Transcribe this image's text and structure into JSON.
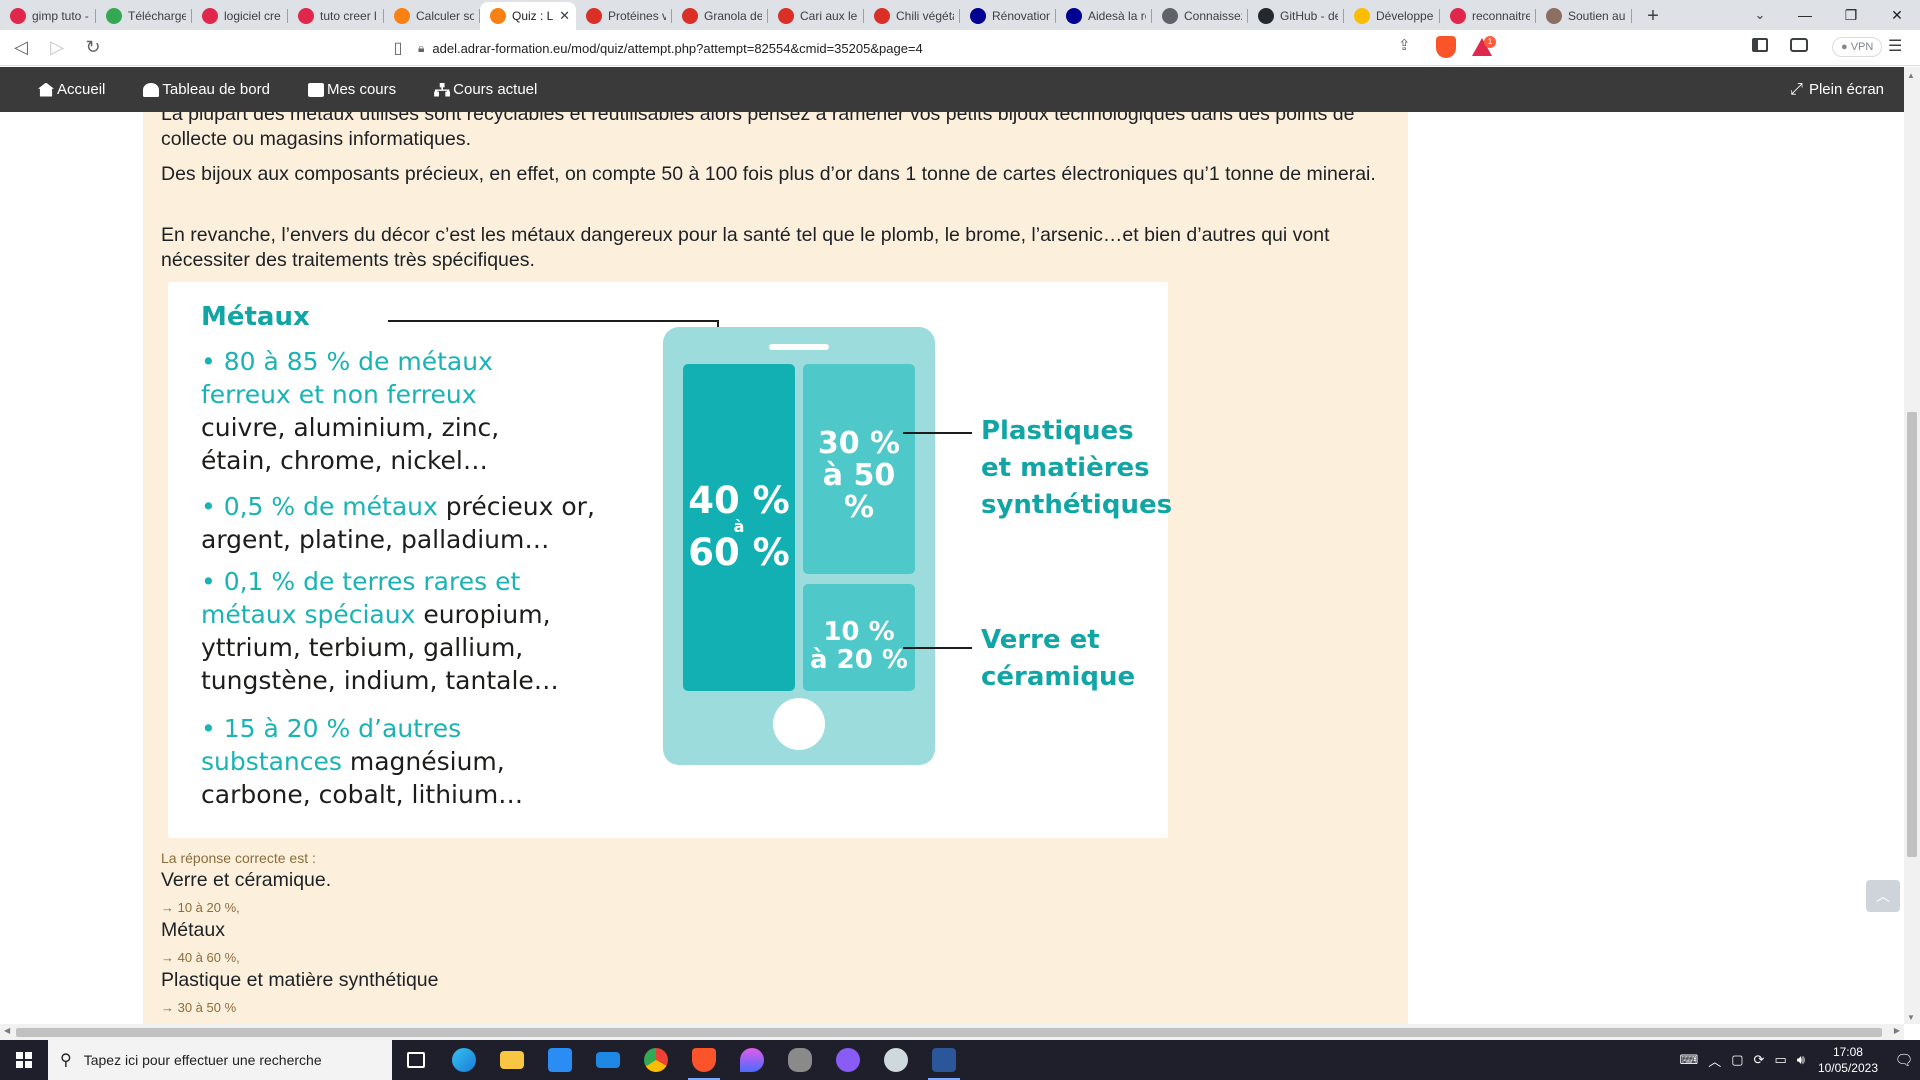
{
  "browser": {
    "tabs": [
      {
        "label": "gimp tuto -",
        "icon": "rewards-icon",
        "color": "#e0284c"
      },
      {
        "label": "Télécharge",
        "icon": "star-icon",
        "color": "#34a853"
      },
      {
        "label": "logiciel cre",
        "icon": "rewards-icon",
        "color": "#e0284c"
      },
      {
        "label": "tuto creer l",
        "icon": "rewards-icon",
        "color": "#e0284c"
      },
      {
        "label": "Calculer so",
        "icon": "moodle-icon",
        "color": "#f98012"
      },
      {
        "label": "Quiz : L",
        "icon": "moodle-icon",
        "color": "#f98012",
        "active": true
      },
      {
        "label": "Protéines v",
        "icon": "red-bar-icon",
        "color": "#d93025"
      },
      {
        "label": "Granola de",
        "icon": "red-bar-icon",
        "color": "#d93025"
      },
      {
        "label": "Cari aux len",
        "icon": "red-bar-icon",
        "color": "#d93025"
      },
      {
        "label": "Chili végéta",
        "icon": "red-bar-icon",
        "color": "#d93025"
      },
      {
        "label": "Rénovation",
        "icon": "flag-icon",
        "color": "#000091"
      },
      {
        "label": "Aidesà la ré",
        "icon": "flag-icon",
        "color": "#000091"
      },
      {
        "label": "Connaissez",
        "icon": "circle-icon",
        "color": "#5f6368"
      },
      {
        "label": "GitHub - de",
        "icon": "github-icon",
        "color": "#24292f"
      },
      {
        "label": "Développer",
        "icon": "ring-icon",
        "color": "#fbbc04"
      },
      {
        "label": "reconnaitre",
        "icon": "rewards-icon",
        "color": "#e0284c"
      },
      {
        "label": "Soutien au",
        "icon": "doc-icon",
        "color": "#8d6e63"
      }
    ],
    "new_tab": "+",
    "url": "adel.adrar-formation.eu/mod/quiz/attempt.php?attempt=82554&cmid=35205&page=4",
    "vpn_label": "VPN",
    "rewards_badge": "1"
  },
  "moodle_nav": {
    "items": [
      {
        "label": "Accueil",
        "icon": "home-icon"
      },
      {
        "label": "Tableau de bord",
        "icon": "dashboard-icon"
      },
      {
        "label": "Mes cours",
        "icon": "briefcase-icon"
      },
      {
        "label": "Cours actuel",
        "icon": "sitemap-icon"
      }
    ],
    "fullscreen": "Plein écran"
  },
  "content": {
    "p1": "La plupart des métaux utilisés sont recyclables et réutilisables alors pensez à ramener vos petits bijoux technologiques dans des points de collecte ou magasins informatiques.",
    "p2": "Des bijoux aux composants précieux, en effet, on compte 50 à 100 fois plus d’or dans 1 tonne de cartes électroniques qu’1 tonne de minerai.",
    "p3": "En revanche, l’envers du décor c’est les métaux dangereux pour la santé tel que le plomb, le brome, l’arsenic…et bien d’autres qui vont nécessiter des traitements très spécifiques."
  },
  "infographic": {
    "title": "Métaux",
    "groups": [
      {
        "teal": "• 80 à 85 % de métaux ferreux et non ferreux",
        "black": "cuivre, aluminium, zinc, étain, chrome, nickel…"
      },
      {
        "teal": "• 0,5 % de métaux",
        "black": "précieux or, argent, platine, palladium…"
      },
      {
        "teal": "• 0,1 % de terres rares et métaux spéciaux",
        "black": "europium, yttrium, terbium, gallium, tungstène, indium, tantale…"
      },
      {
        "teal": "• 15 à 20 % d’autres substances",
        "black": "magnésium, carbone, cobalt, lithium…"
      }
    ],
    "pct_metaux": [
      "40 %",
      "à",
      "60 %"
    ],
    "pct_plastiques": [
      "30 %",
      "à 50 %"
    ],
    "pct_verre": [
      "10 %",
      "à 20 %"
    ],
    "label_plastiques": [
      "Plastiques",
      "et matières",
      "synthétiques"
    ],
    "label_verre": [
      "Verre et",
      "céramique"
    ],
    "colors": {
      "phone_light": "#9ddcdd",
      "block_dark": "#12b0b2",
      "block_mid": "#4fc8c9",
      "teal_text": "#12a5a6"
    }
  },
  "answer": {
    "intro": "La réponse correcte est :",
    "items": [
      {
        "name": "Verre et céramique.",
        "value": "→ 10 à 20 %,"
      },
      {
        "name": "Métaux",
        "value": "→ 40 à 60 %,"
      },
      {
        "name": "Plastique et matière synthétique",
        "value": "→ 30 à 50 %"
      }
    ]
  },
  "taskbar": {
    "search_placeholder": "Tapez ici pour effectuer une recherche",
    "time": "17:08",
    "date": "10/05/2023"
  }
}
